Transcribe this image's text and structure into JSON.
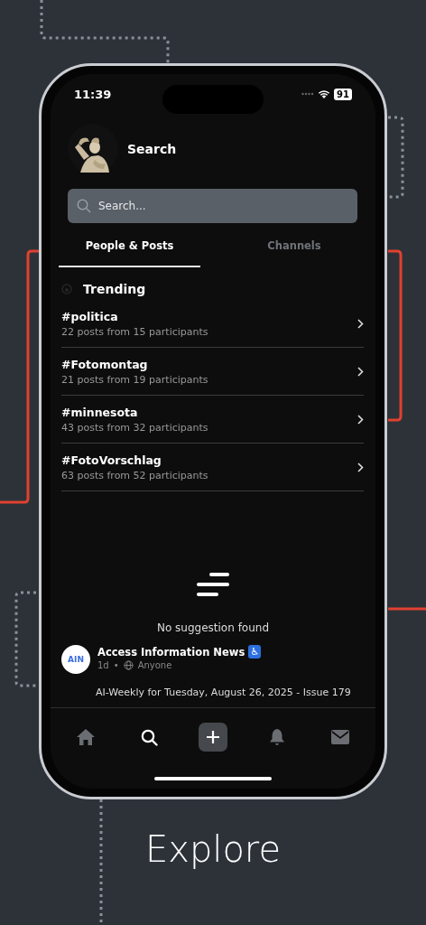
{
  "status_bar": {
    "time": "11:39",
    "battery": "91"
  },
  "header": {
    "title": "Search"
  },
  "search": {
    "placeholder": "Search..."
  },
  "tabs": [
    {
      "label": "People & Posts",
      "selected": true
    },
    {
      "label": "Channels",
      "selected": false
    }
  ],
  "trending": {
    "title": "Trending",
    "items": [
      {
        "tag": "#politica",
        "stats": "22 posts from 15 participants"
      },
      {
        "tag": "#Fotomontag",
        "stats": "21 posts from 19 participants"
      },
      {
        "tag": "#minnesota",
        "stats": "43 posts from 32 participants"
      },
      {
        "tag": "#FotoVorschlag",
        "stats": "63 posts from 52 participants"
      }
    ]
  },
  "empty_state": {
    "message": "No suggestion found"
  },
  "post": {
    "avatar_text": "AIN",
    "author": "Access Information News",
    "badge": "♿",
    "age": "1d",
    "separator": "•",
    "audience": "Anyone",
    "text": "AI-Weekly for Tuesday, August 26, 2025 - Issue 179"
  },
  "nav": [
    {
      "kind": "home",
      "selected": false
    },
    {
      "kind": "search",
      "selected": true
    },
    {
      "kind": "compose",
      "selected": false
    },
    {
      "kind": "bell",
      "selected": false
    },
    {
      "kind": "mail",
      "selected": false
    }
  ],
  "caption": "Explore"
}
